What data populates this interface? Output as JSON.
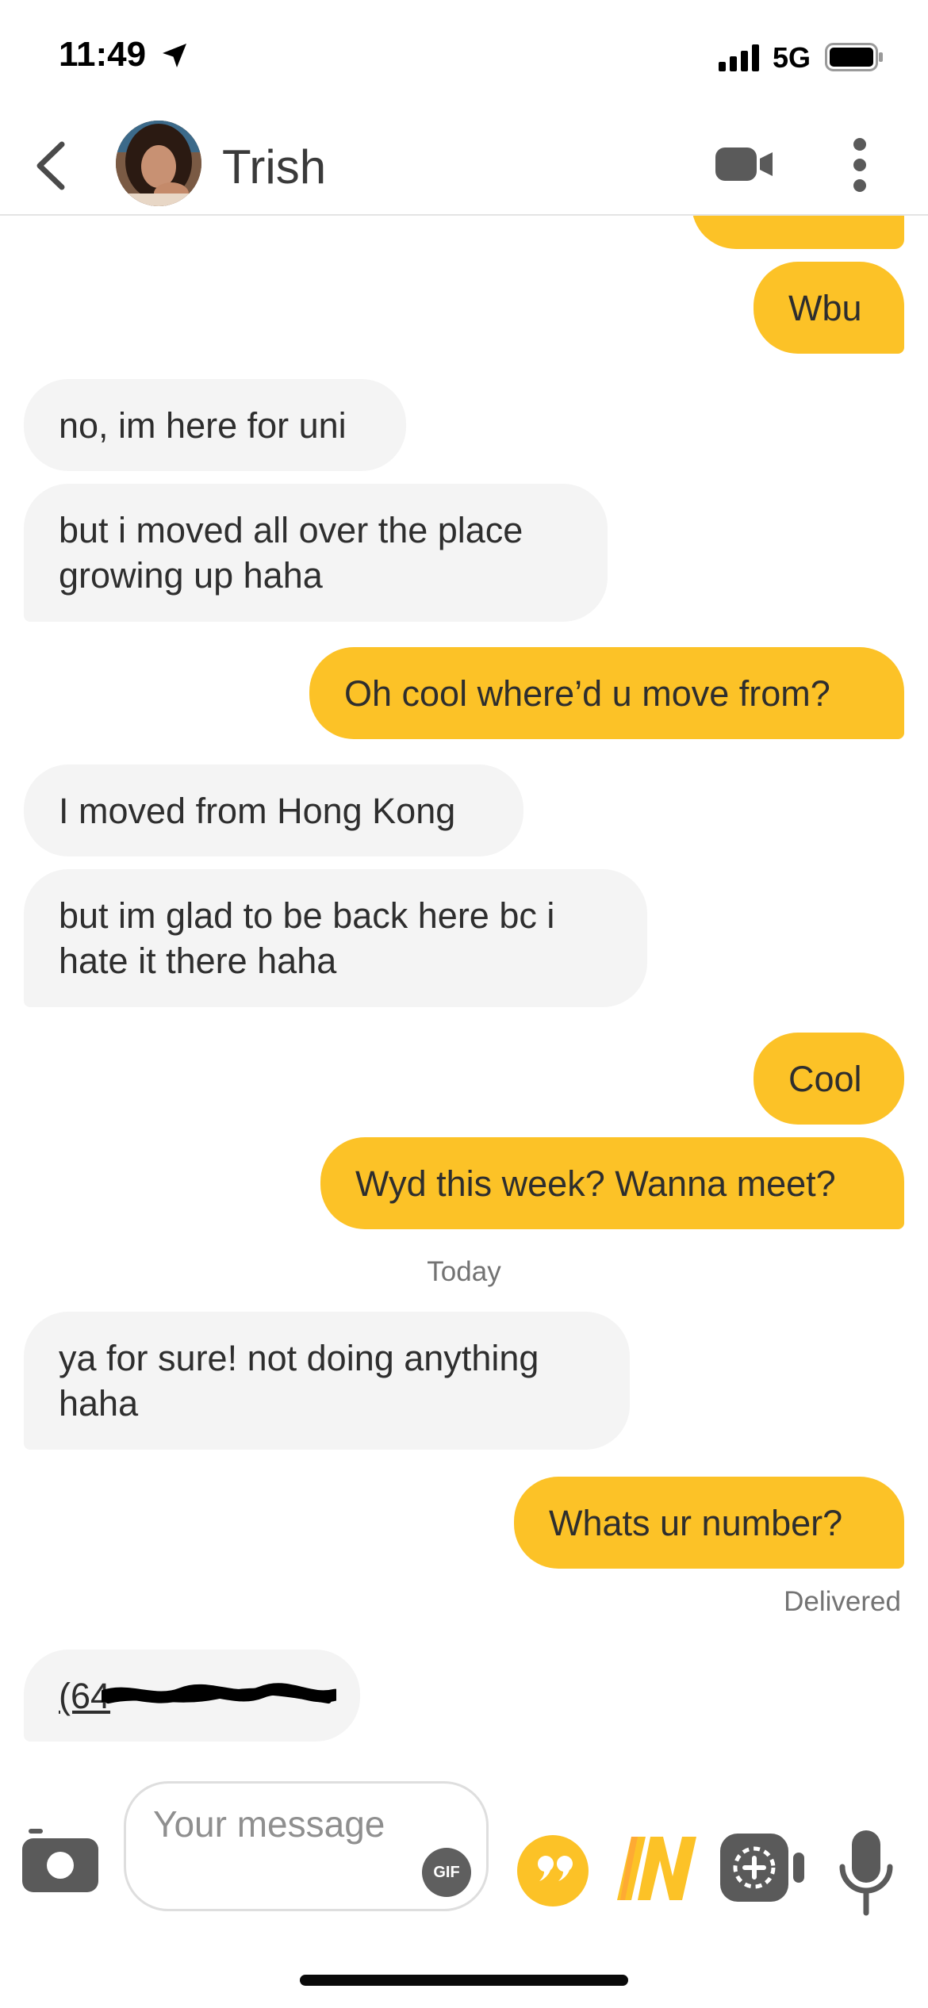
{
  "status_bar": {
    "time": "11:49",
    "network": "5G"
  },
  "header": {
    "contact_name": "Trish"
  },
  "colors": {
    "accent": "#fcc227",
    "incoming_bubble": "#f4f4f4"
  },
  "messages": [
    {
      "from": "me",
      "text": "Wbu"
    },
    {
      "from": "them",
      "text": "no, im here for uni"
    },
    {
      "from": "them",
      "text": "but i moved all over the place growing up haha"
    },
    {
      "from": "me",
      "text": "Oh cool where’d u move from?"
    },
    {
      "from": "them",
      "text": "I moved from Hong Kong"
    },
    {
      "from": "them",
      "text": "but im glad to be back here bc i hate it there haha"
    },
    {
      "from": "me",
      "text": "Cool"
    },
    {
      "from": "me",
      "text": "Wyd this week? Wanna meet?"
    },
    {
      "from": "them",
      "text": "ya for sure! not doing anything haha"
    },
    {
      "from": "me",
      "text": "Whats ur number?"
    },
    {
      "from": "them",
      "text": "(64"
    }
  ],
  "day_separator": "Today",
  "delivery_status": "Delivered",
  "composer": {
    "placeholder": "Your message",
    "gif_label": "GIF"
  },
  "icons": [
    "location-arrow-icon",
    "signal-icon",
    "battery-icon",
    "back-chevron-icon",
    "video-call-icon",
    "more-vertical-icon",
    "camera-icon",
    "quote-icon",
    "in-badge-icon",
    "snapchat-icon",
    "microphone-icon"
  ]
}
